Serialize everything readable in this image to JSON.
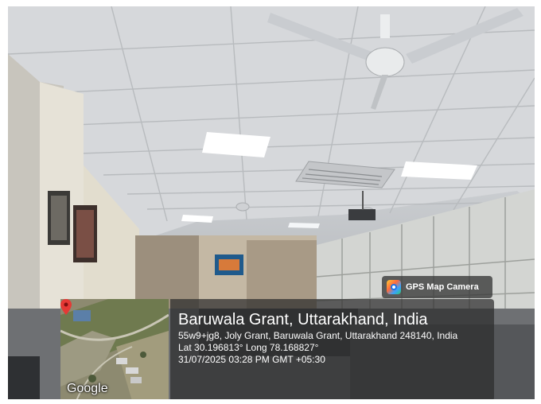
{
  "badge": {
    "label": "GPS Map Camera",
    "icon": "gps-map-camera-icon"
  },
  "map": {
    "attribution": "Google",
    "pin_color": "#e53935"
  },
  "location": {
    "title": "Baruwala Grant, Uttarakhand, India",
    "address": "55w9+jg8, Joly Grant, Baruwala Grant, Uttarakhand 248140, India",
    "coordinates": "Lat 30.196813° Long 78.168827°",
    "timestamp": "31/07/2025 03:28 PM GMT +05:30"
  }
}
